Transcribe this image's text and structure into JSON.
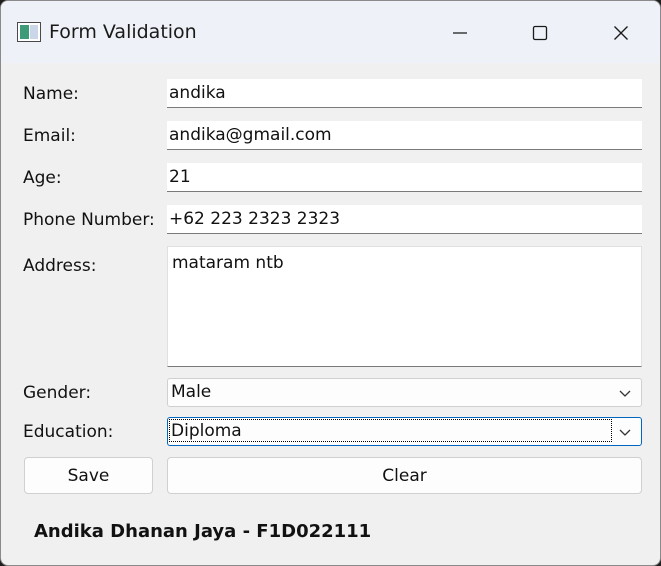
{
  "window": {
    "title": "Form Validation",
    "controls": [
      "minimize-icon",
      "maximize-icon",
      "close-icon"
    ]
  },
  "form": {
    "name": {
      "label": "Name:",
      "value": "andika"
    },
    "email": {
      "label": "Email:",
      "value": "andika@gmail.com"
    },
    "age": {
      "label": "Age:",
      "value": "21"
    },
    "phone": {
      "label": "Phone Number:",
      "value": "+62 223 2323 2323"
    },
    "address": {
      "label": "Address:",
      "value": "mataram ntb"
    },
    "gender": {
      "label": "Gender:",
      "value": "Male"
    },
    "education": {
      "label": "Education:",
      "value": "Diploma"
    }
  },
  "buttons": {
    "save_label": "Save",
    "clear_label": "Clear"
  },
  "footer": {
    "text": "Andika Dhanan Jaya - F1D022111"
  },
  "colors": {
    "window_bg": "#f0f0f0",
    "titlebar_bg": "#eef1f7",
    "focus_accent": "#0067c0"
  }
}
